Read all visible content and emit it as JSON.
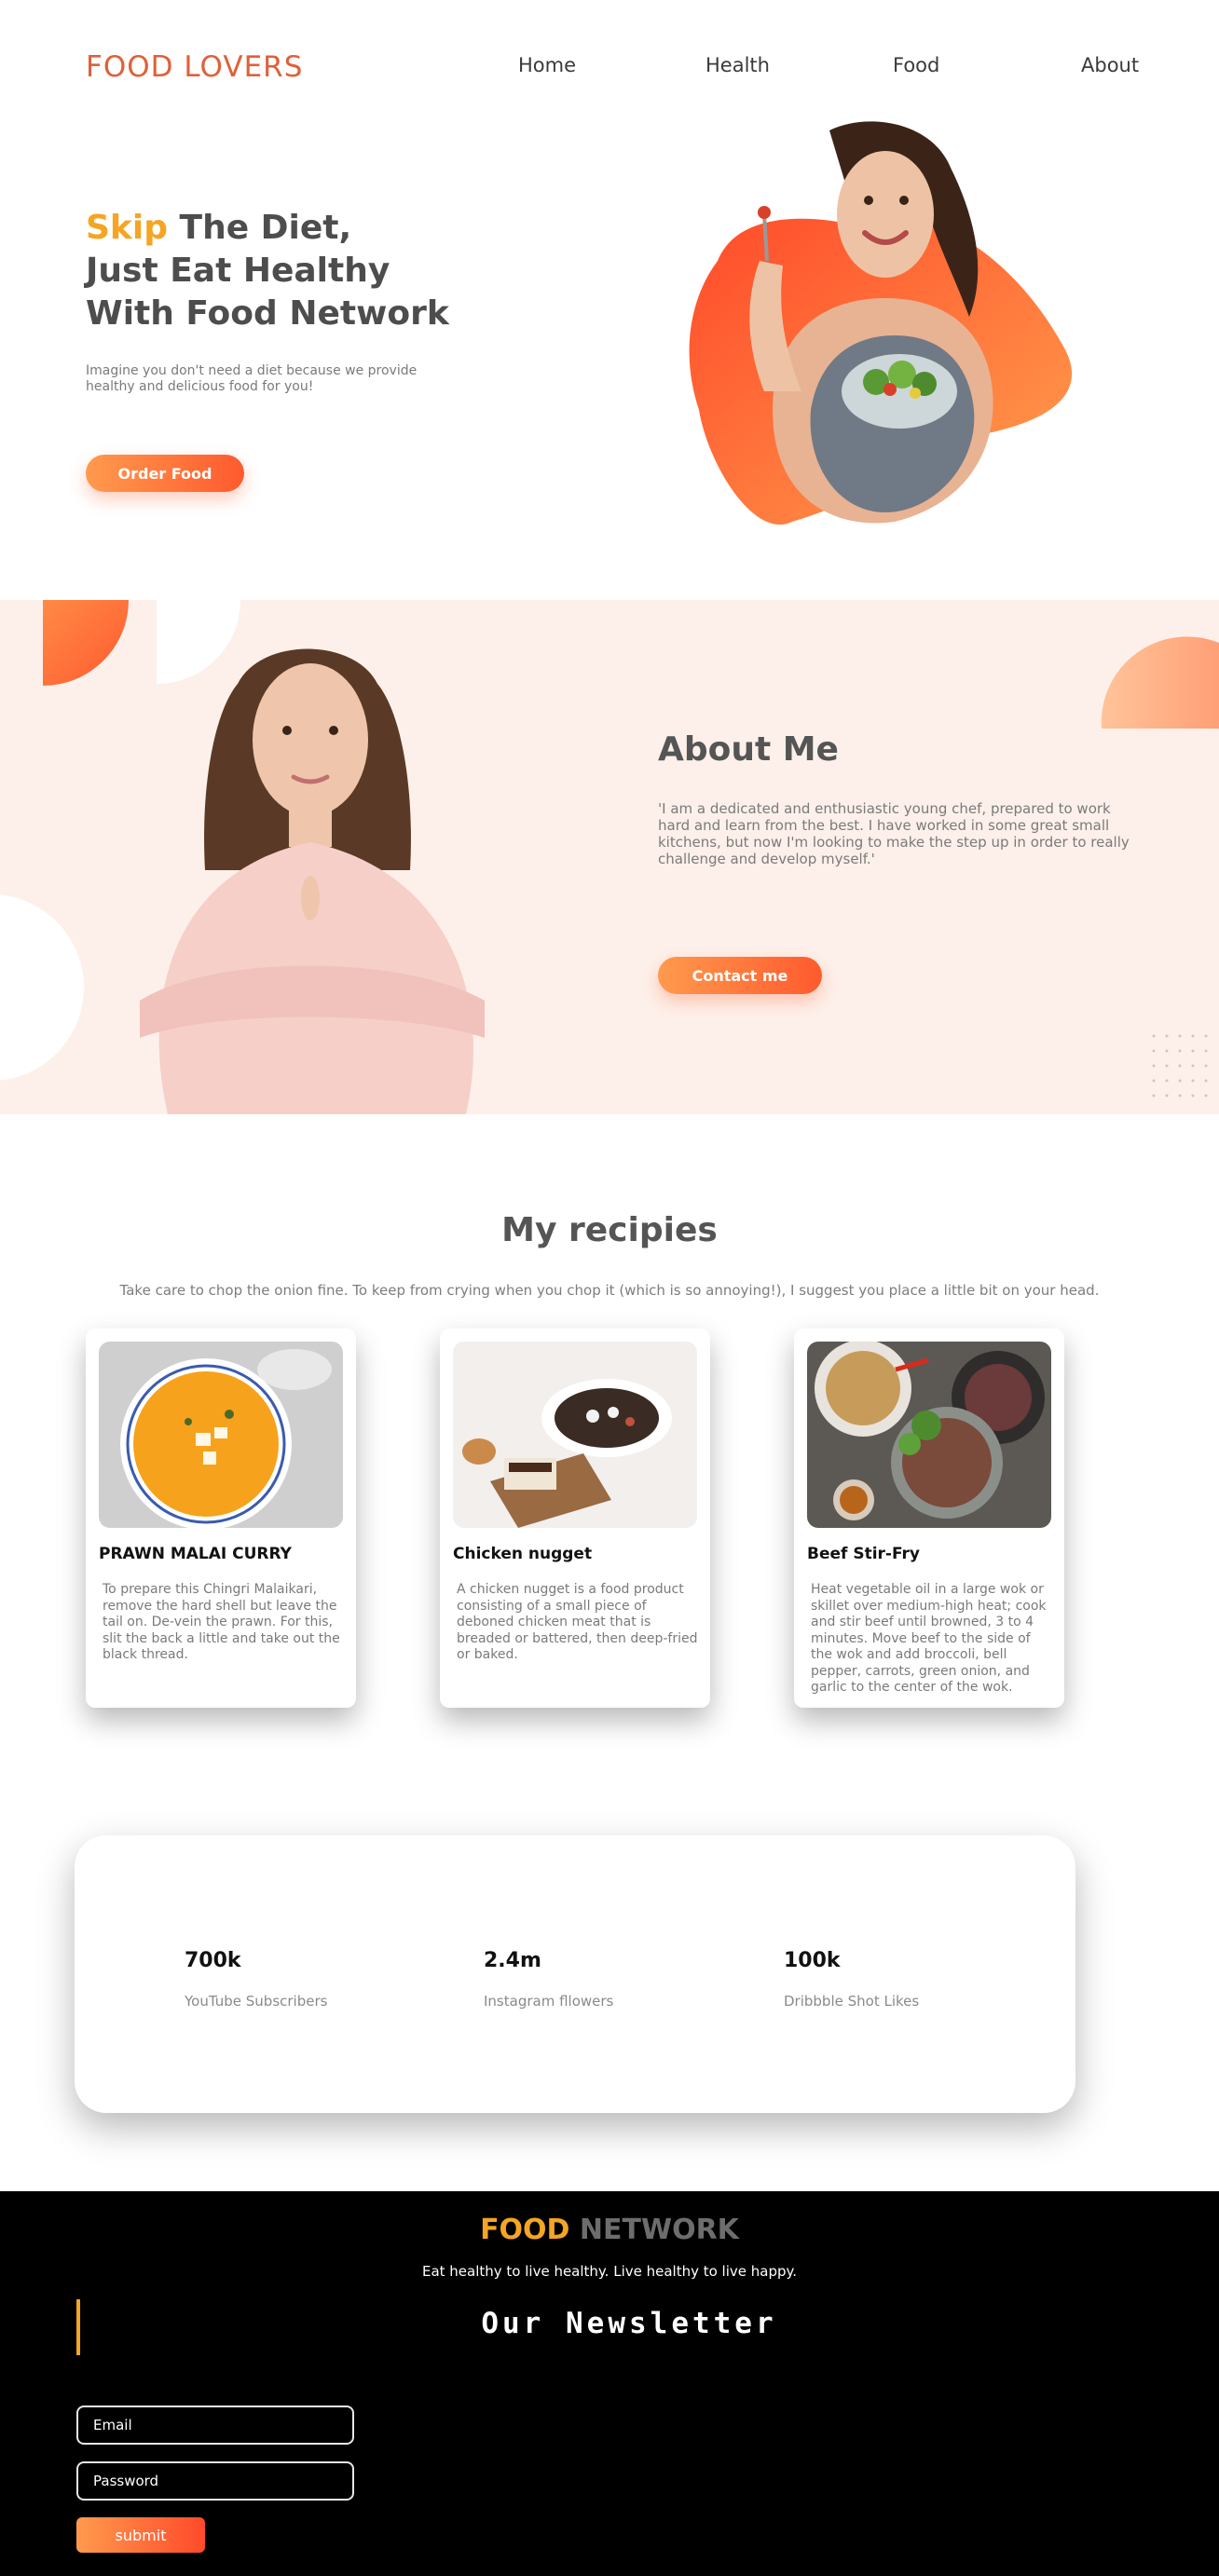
{
  "nav": {
    "logo": "FOOD LOVERS",
    "links": [
      "Home",
      "Health",
      "Food",
      "About"
    ]
  },
  "hero": {
    "title_accent": "Skip",
    "title_line1_rest": " The Diet,",
    "title_line2": "Just Eat Healthy",
    "title_line3": "With Food Network",
    "description": "Imagine you don't need a diet because we provide healthy and delicious food for you!",
    "button": "Order Food"
  },
  "about": {
    "title": "About Me",
    "text": "'I am a dedicated and enthusiastic young chef, prepared to work hard and learn from the best. I have worked in some great small kitchens, but now I'm looking to make the step up in order to really challenge and develop myself.'",
    "button": "Contact me"
  },
  "recipes": {
    "title": "My recipies",
    "subtitle": "Take care to chop the onion fine. To keep from crying when you chop it (which is so annoying!), I suggest you place a little bit on your head.",
    "cards": [
      {
        "title": "PRAWN MALAI CURRY",
        "text": "To prepare this Chingri Malaikari, remove the hard shell but leave the tail on. De-vein the prawn. For this, slit the back a little and take out the black thread."
      },
      {
        "title": "Chicken nugget",
        "text": "A chicken nugget is a food product consisting of a small piece of deboned chicken meat that is breaded or battered, then deep-fried or baked."
      },
      {
        "title": "Beef Stir-Fry",
        "text": "Heat vegetable oil in a large wok or skillet over medium-high heat; cook and stir beef until browned, 3 to 4 minutes. Move beef to the side of the wok and add broccoli, bell pepper, carrots, green onion, and garlic to the center of the wok."
      }
    ]
  },
  "stats": [
    {
      "value": "700k",
      "label": "YouTube Subscribers"
    },
    {
      "value": "2.4m",
      "label": "Instagram fllowers"
    },
    {
      "value": "100k",
      "label": "Dribbble Shot Likes"
    }
  ],
  "footer": {
    "brand_part1": "FOOD",
    "brand_part2": " NETWORK",
    "tagline": "Eat healthy to live healthy. Live healthy to live happy.",
    "newsletter_title": "Our Newsletter",
    "email_placeholder": "Email",
    "password_placeholder": "Password",
    "submit": "submit"
  },
  "colors": {
    "accent": "#f5a523",
    "brand_orange": "#ff6a3d",
    "logo": "#e0603a",
    "about_bg": "#fdf0ea",
    "footer_bg": "#000000"
  }
}
